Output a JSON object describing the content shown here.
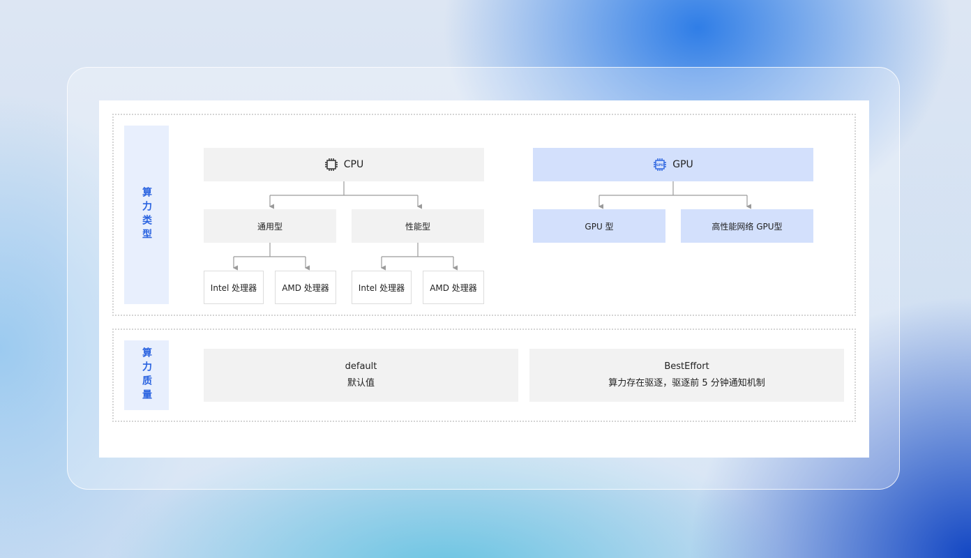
{
  "sections": {
    "type": {
      "label": "算力类型"
    },
    "quality": {
      "label": "算力质量"
    }
  },
  "cpu": {
    "title": "CPU",
    "general": "通用型",
    "performance": "性能型",
    "general_intel": "Intel 处理器",
    "general_amd": "AMD 处理器",
    "performance_intel": "Intel 处理器",
    "performance_amd": "AMD 处理器"
  },
  "gpu": {
    "title": "GPU",
    "chip_text": "GPU",
    "gpu_type": "GPU 型",
    "hpn_gpu_type": "高性能网络 GPU型"
  },
  "quality": {
    "default_title": "default",
    "default_desc": "默认值",
    "besteffort_title": "BestEffort",
    "besteffort_desc": "算力存在驱逐，驱逐前 5 分钟通知机制"
  },
  "colors": {
    "accent_blue": "#2a63e0",
    "gpu_fill": "#d3e0fc",
    "cpu_fill": "#f2f2f2",
    "connector": "#9a9a9a"
  },
  "icons": {
    "cpu": "cpu-chip-icon",
    "gpu": "gpu-chip-icon"
  }
}
